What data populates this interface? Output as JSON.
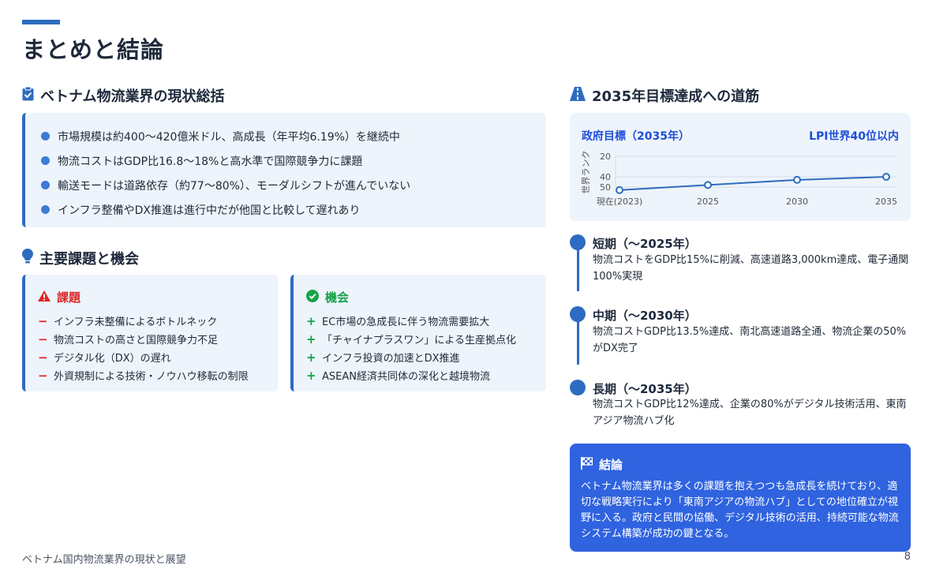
{
  "page": {
    "title": "まとめと結論",
    "footer": "ベトナム国内物流業界の現状と展望",
    "page_number": "8"
  },
  "summary": {
    "heading": "ベトナム物流業界の現状総括",
    "items": [
      "市場規模は約400〜420億米ドル、高成長（年平均6.19%）を継続中",
      "物流コストはGDP比16.8〜18%と高水準で国際競争力に課題",
      "輸送モードは道路依存（約77〜80%）、モーダルシフトが進んでいない",
      "インフラ整備やDX推進は進行中だが他国と比較して遅れあり"
    ]
  },
  "issues": {
    "heading": "主要課題と機会",
    "challenges": {
      "title": "課題",
      "color": "#dc2626",
      "items": [
        "インフラ未整備によるボトルネック",
        "物流コストの高さと国際競争力不足",
        "デジタル化（DX）の遅れ",
        "外資規制による技術・ノウハウ移転の制限"
      ]
    },
    "opportunities": {
      "title": "機会",
      "color": "#16a34a",
      "items": [
        "EC市場の急成長に伴う物流需要拡大",
        "「チャイナプラスワン」による生産拠点化",
        "インフラ投資の加速とDX推進",
        "ASEAN経済共同体の深化と越境物流"
      ]
    }
  },
  "roadmap": {
    "heading": "2035年目標達成への道筋",
    "chart_header_left": "政府目標（2035年）",
    "chart_header_right": "LPI世界40位以内",
    "timeline": [
      {
        "title": "短期（〜2025年）",
        "desc": "物流コストをGDP比15%に削減、高速道路3,000km達成、電子通関100%実現"
      },
      {
        "title": "中期（〜2030年）",
        "desc": "物流コストGDP比13.5%達成、南北高速道路全通、物流企業の50%がDX完了"
      },
      {
        "title": "長期（〜2035年）",
        "desc": "物流コストGDP比12%達成、企業の80%がデジタル技術活用、東南アジア物流ハブ化"
      }
    ]
  },
  "conclusion": {
    "title": "結論",
    "body": "ベトナム物流業界は多くの課題を抱えつつも急成長を続けており、適切な戦略実行により「東南アジアの物流ハブ」としての地位確立が視野に入る。政府と民間の協働、デジタル技術の活用、持続可能な物流システム構築が成功の鍵となる。"
  },
  "colors": {
    "accent": "#2d6cc0",
    "panel_bg": "#eef4fb",
    "conclusion_bg": "#2f63df"
  },
  "chart_data": {
    "type": "line",
    "categories": [
      "現在(2023)",
      "2025",
      "2030",
      "2035"
    ],
    "series": [
      {
        "values": [
          53,
          48,
          43,
          40
        ]
      }
    ],
    "ylabel": "世界ランク",
    "yticks": [
      "20",
      "40",
      "50"
    ],
    "ylim": [
      20,
      50
    ],
    "y_inverted": true,
    "grid": true
  }
}
